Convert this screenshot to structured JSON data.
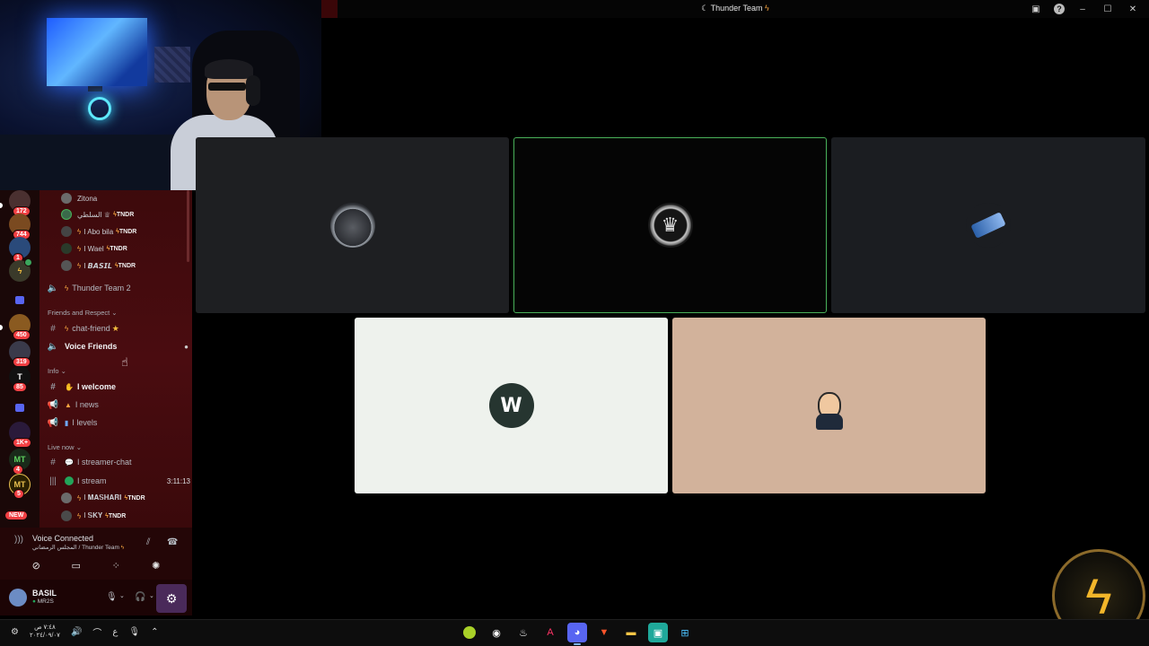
{
  "window": {
    "title": "Thunder Team",
    "title_icon_left": "crescent-icon",
    "title_icon_right": "lightning-icon"
  },
  "server_rail": {
    "badges": [
      "172",
      "744",
      "1",
      "450",
      "319",
      "85",
      "1K+",
      "4",
      "5"
    ],
    "new_label": "NEW",
    "server_letters": [
      "T",
      "MT",
      "MT"
    ]
  },
  "channels": {
    "members_top": [
      {
        "name": "Zitona",
        "tag": ""
      },
      {
        "name": "السلطي ♕",
        "tag": "TNDR"
      },
      {
        "name": "I Abo bila",
        "tag": "TNDR"
      },
      {
        "name": "I Wael",
        "tag": "TNDR"
      },
      {
        "name": "I 𝘽𝘼𝙎𝙄𝙇",
        "tag": "TNDR"
      }
    ],
    "voice_thunder2": "Thunder Team 2",
    "category_friends": "Friends and Respect",
    "chat_friend": "chat-friend",
    "voice_friends": "Voice Friends",
    "category_info": "Info",
    "welcome": "I welcome",
    "news": "I news",
    "levels": "I levels",
    "category_live": "Live now",
    "streamer_chat": "I streamer-chat",
    "stream": "I stream",
    "stream_timer": "3:11:13",
    "members_stream": [
      {
        "name": "I 𝐌𝐀𝐒𝐇𝐀𝐑𝐈",
        "tag": "TNDR"
      },
      {
        "name": "I 𝐒𝐊𝐘",
        "tag": "TNDR"
      }
    ]
  },
  "voice_panel": {
    "status": "Voice Connected",
    "subtitle": "المجلس الرمضاني / Thunder Team"
  },
  "user_panel": {
    "username": "BASIL",
    "status": "MR2S"
  },
  "taskbar": {
    "clock_time": "٧:٤٨ ص",
    "clock_date": "٢٠٢٤/٠٩/٠٧",
    "lang": "ع",
    "apps": [
      "tennis-ball-icon",
      "obs-icon",
      "steam-icon",
      "adobe-icon",
      "discord-icon",
      "brave-icon",
      "folder-icon",
      "app-icon",
      "start-icon"
    ]
  },
  "colors": {
    "sidebar_bg": "#3d0a0c",
    "speaking_border": "#49b15a",
    "accent": "#f4a340"
  }
}
